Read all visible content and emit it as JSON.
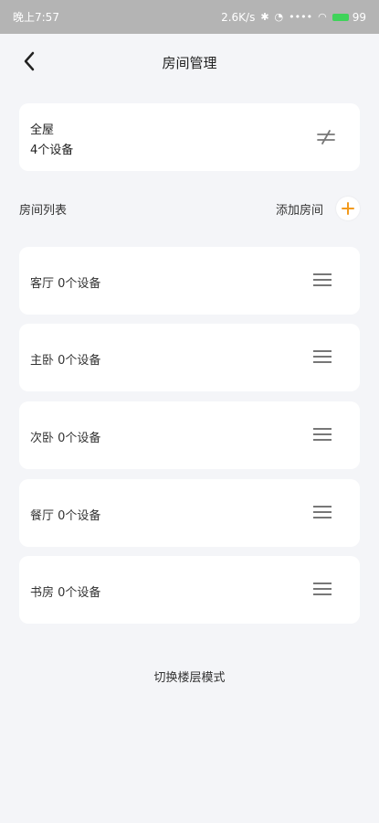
{
  "status_bar": {
    "time": "晚上7:57",
    "network": "2.6K/s",
    "battery": "99"
  },
  "header": {
    "title": "房间管理"
  },
  "whole_house": {
    "title": "全屋",
    "subtitle": "4个设备"
  },
  "room_list": {
    "title": "房间列表",
    "add_label": "添加房间",
    "items": [
      {
        "label": "客厅 0个设备"
      },
      {
        "label": "主卧 0个设备"
      },
      {
        "label": "次卧 0个设备"
      },
      {
        "label": "餐厅 0个设备"
      },
      {
        "label": "书房 0个设备"
      }
    ]
  },
  "footer": {
    "switch_label": "切换楼层模式"
  },
  "colors": {
    "accent": "#f39a1b",
    "background": "#f4f5f8",
    "card": "#ffffff"
  },
  "icons": {
    "back": "back-chevron-icon",
    "settings": "settings-slider-icon",
    "add": "plus-icon",
    "drag": "drag-handle-icon"
  }
}
